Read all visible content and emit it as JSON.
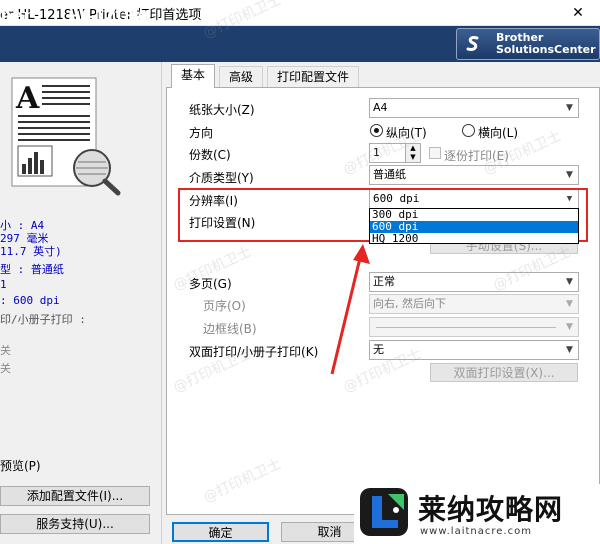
{
  "window": {
    "title": "er HL-1218W Printer 打印首选项",
    "close_glyph": "✕"
  },
  "brand": {
    "logo_text": "her",
    "model": "HL-1218W",
    "solutions_line1": "Brother",
    "solutions_line2": "SolutionsCenter"
  },
  "summary": {
    "lines": [
      "小 : A4",
      "297 毫米",
      "11.7 英寸)",
      "型 : 普通纸",
      "1",
      ": 600 dpi",
      "印/小册子打印 :",
      "关",
      "关"
    ],
    "preview_label": "预览(P)",
    "add_profile_button": "添加配置文件(I)...",
    "support_button": "服务支持(U)..."
  },
  "tabs": [
    {
      "label": "基本",
      "active": true
    },
    {
      "label": "高级",
      "active": false
    },
    {
      "label": "打印配置文件",
      "active": false
    }
  ],
  "basic": {
    "paper_size": {
      "label": "纸张大小(Z)",
      "value": "A4"
    },
    "orientation": {
      "label": "方向",
      "portrait": "纵向(T)",
      "landscape": "横向(L)",
      "selected": "portrait"
    },
    "copies": {
      "label": "份数(C)",
      "value": "1",
      "collate_label": "逐份打印(E)"
    },
    "media_type": {
      "label": "介质类型(Y)",
      "value": "普通纸"
    },
    "resolution": {
      "label": "分辨率(I)",
      "value": "600 dpi",
      "options": [
        "300 dpi",
        "600 dpi",
        "HQ 1200"
      ],
      "selected_index": 1
    },
    "print_settings": {
      "label": "打印设置(N)",
      "button": "手动设置(S)..."
    },
    "multi_page": {
      "label": "多页(G)",
      "value": "正常"
    },
    "page_order": {
      "label": "页序(O)",
      "value": "向右, 然后向下"
    },
    "border_line": {
      "label": "边框线(B)",
      "value": ""
    },
    "duplex": {
      "label": "双面打印/小册子打印(K)",
      "value": "无",
      "button": "双面打印设置(X)..."
    }
  },
  "footer": {
    "ok": "确定",
    "cancel": "取消"
  },
  "watermark_text": "@打印机卫士",
  "site": {
    "name": "莱纳攻略网",
    "url": "www.laitnacre.com"
  },
  "colors": {
    "brand_bar": "#1e3f6e",
    "highlight_box": "#e52521",
    "selection": "#0078d7",
    "summary_text": "#0000c0"
  }
}
